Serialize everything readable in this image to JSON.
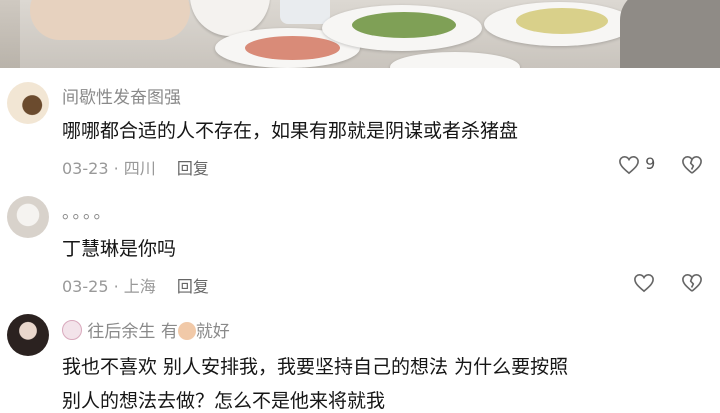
{
  "comments": [
    {
      "username": "间歇性发奋图强",
      "text": "哪哪都合适的人不存在，如果有那就是阴谋或者杀猪盘",
      "date": "03-23",
      "location": "四川",
      "reply_label": "回复",
      "likes": "9"
    },
    {
      "username": "。。。。",
      "text": "丁慧琳是你吗",
      "date": "03-25",
      "location": "上海",
      "reply_label": "回复"
    },
    {
      "username_part1": "往后余生",
      "username_part2": "有",
      "username_part3": "就好",
      "text_line1": "我也不喜欢  别人安排我，我要坚持自己的想法  为什么要按照",
      "text_line2": "别人的想法去做？怎么不是他来将就我"
    }
  ],
  "icons": {
    "like": "heart-outline-icon",
    "dislike": "broken-heart-icon"
  },
  "colors": {
    "text": "#161616",
    "meta": "#999999",
    "username": "#8a8a8a"
  }
}
